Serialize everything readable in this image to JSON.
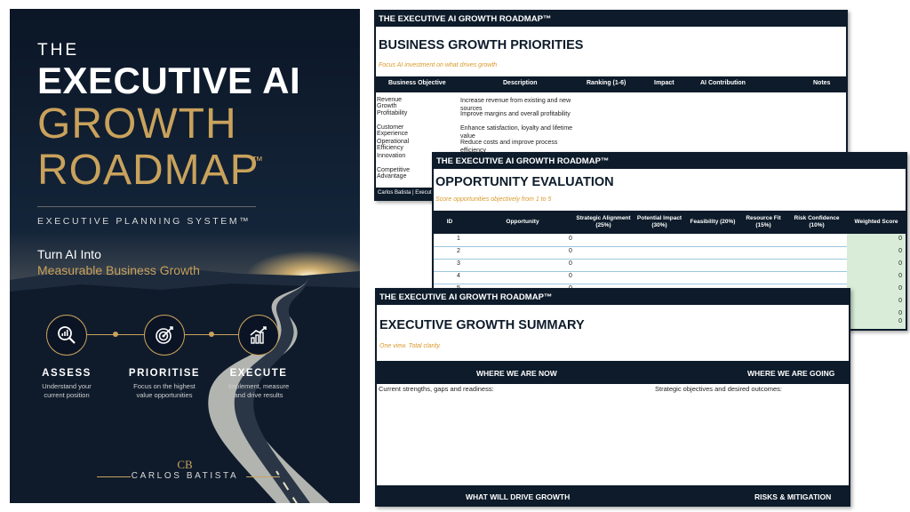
{
  "cover": {
    "the": "THE",
    "title_line1": "EXECUTIVE AI",
    "title_line2": "GROWTH",
    "title_line3": "ROADMAP",
    "tm": "™",
    "system": "EXECUTIVE PLANNING SYSTEM™",
    "tagline_1": "Turn AI Into",
    "tagline_2": "Measurable Business Growth",
    "steps": [
      {
        "icon": "magnifier-chart-icon",
        "title": "ASSESS",
        "desc_1": "Understand your",
        "desc_2": "current position"
      },
      {
        "icon": "target-icon",
        "title": "PRIORITISE",
        "desc_1": "Focus on the highest",
        "desc_2": "value opportunities"
      },
      {
        "icon": "bar-chart-up-icon",
        "title": "EXECUTE",
        "desc_1": "Implement, measure",
        "desc_2": "and drive results"
      }
    ],
    "monogram": "CB",
    "author": "CARLOS BATISTA",
    "colors": {
      "navy": "#0d1a2b",
      "gold": "#c9a25c"
    }
  },
  "sheet1": {
    "header": "THE EXECUTIVE AI GROWTH ROADMAP™",
    "title": "BUSINESS GROWTH PRIORITIES",
    "tagline": "Focus AI investment on what drives growth",
    "columns": [
      "Business Objective",
      "Description",
      "Ranking (1-6)",
      "Impact",
      "AI Contribution",
      "Notes"
    ],
    "rows": [
      {
        "objective": "Revenue Growth",
        "description": "Increase revenue from existing and new sources"
      },
      {
        "objective": "Profitability",
        "description": "Improve margins and overall profitability"
      },
      {
        "objective": "Customer Experience",
        "description": "Enhance satisfaction, loyalty and lifetime value"
      },
      {
        "objective": "Operational Efficiency",
        "description": "Reduce costs and improve process efficiency"
      },
      {
        "objective": "Innovation",
        "description": ""
      },
      {
        "objective": "Competitive Advantage",
        "description": ""
      }
    ],
    "footer": "Carlos Batista | Executive"
  },
  "sheet2": {
    "header": "THE EXECUTIVE AI GROWTH ROADMAP™",
    "title": "OPPORTUNITY EVALUATION",
    "tagline": "Score opportunities objectively from 1 to 5",
    "columns": [
      "ID",
      "Opportunity",
      "Strategic Alignment (25%)",
      "Potential Impact (30%)",
      "Feasibility (20%)",
      "Resource Fit (15%)",
      "Risk Confidence (10%)",
      "Weighted Score"
    ],
    "rows": [
      {
        "id": "1",
        "opportunity": "0",
        "score": "0"
      },
      {
        "id": "2",
        "opportunity": "0",
        "score": "0"
      },
      {
        "id": "3",
        "opportunity": "0",
        "score": "0"
      },
      {
        "id": "4",
        "opportunity": "0",
        "score": "0"
      },
      {
        "id": "5",
        "opportunity": "0",
        "score": "0"
      },
      {
        "id": "",
        "opportunity": "",
        "score": "0"
      },
      {
        "id": "",
        "opportunity": "",
        "score": "0"
      },
      {
        "id": "",
        "opportunity": "",
        "score": "0"
      }
    ]
  },
  "sheet3": {
    "header": "THE EXECUTIVE AI GROWTH ROADMAP™",
    "title": "EXECUTIVE GROWTH SUMMARY",
    "tagline": "One view. Total clarity.",
    "where_now": "WHERE WE ARE NOW",
    "where_going": "WHERE WE ARE GOING",
    "now_text": "Current strengths, gaps and readiness:",
    "going_text": "Strategic objectives and desired outcomes:",
    "drive_growth": "WHAT WILL DRIVE GROWTH",
    "risks": "RISKS & MITIGATION"
  }
}
